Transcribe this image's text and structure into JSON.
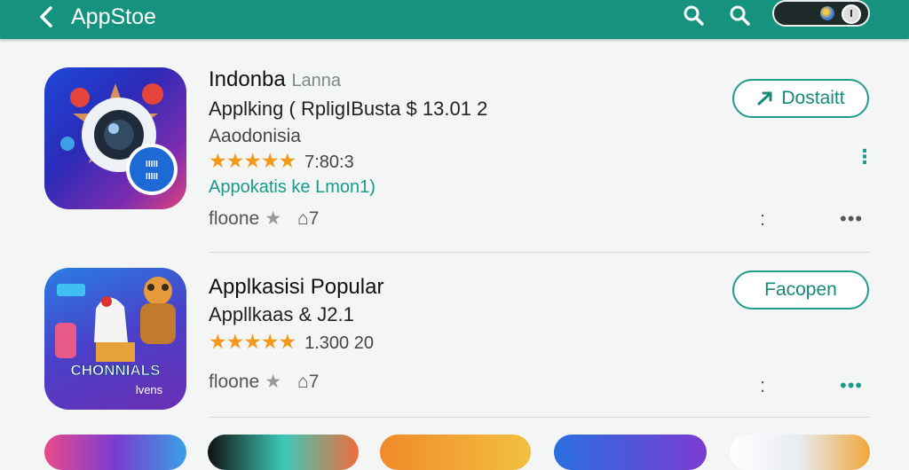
{
  "header": {
    "title": "AppStoe",
    "icons": [
      "back-arrow-icon",
      "search-icon",
      "search-icon",
      "toggle-switch"
    ]
  },
  "apps": [
    {
      "name": "Indonba",
      "name_sub": "Lanna",
      "line1": "Applking ( RpligIBusta $  13.01 2",
      "line2": "Aaodonisia",
      "stars": "★★★★★",
      "rating": "7:80:3",
      "category": "Appokatis ke Lmon1)",
      "meta_label": "floone",
      "meta_star": "★",
      "meta_pkg": "7",
      "button": "Dostaitt",
      "side_dots": "⋮",
      "dots_small": ":",
      "dots_more": "•••"
    },
    {
      "name": "Applkasisi Popular",
      "line1": "Appllkaas &   J2.1",
      "stars": "★★★★★",
      "rating": "1.300 20",
      "meta_label": "floone",
      "meta_star": "★",
      "meta_pkg": "7",
      "button": "Facopen",
      "dots_small": ":",
      "dots_more": "•••",
      "icon_text_1": "CHONNIALS",
      "icon_text_2": "lvens"
    }
  ],
  "colors": {
    "header": "#15937e",
    "accent": "#1f9c8a",
    "star": "#f39a1d"
  }
}
